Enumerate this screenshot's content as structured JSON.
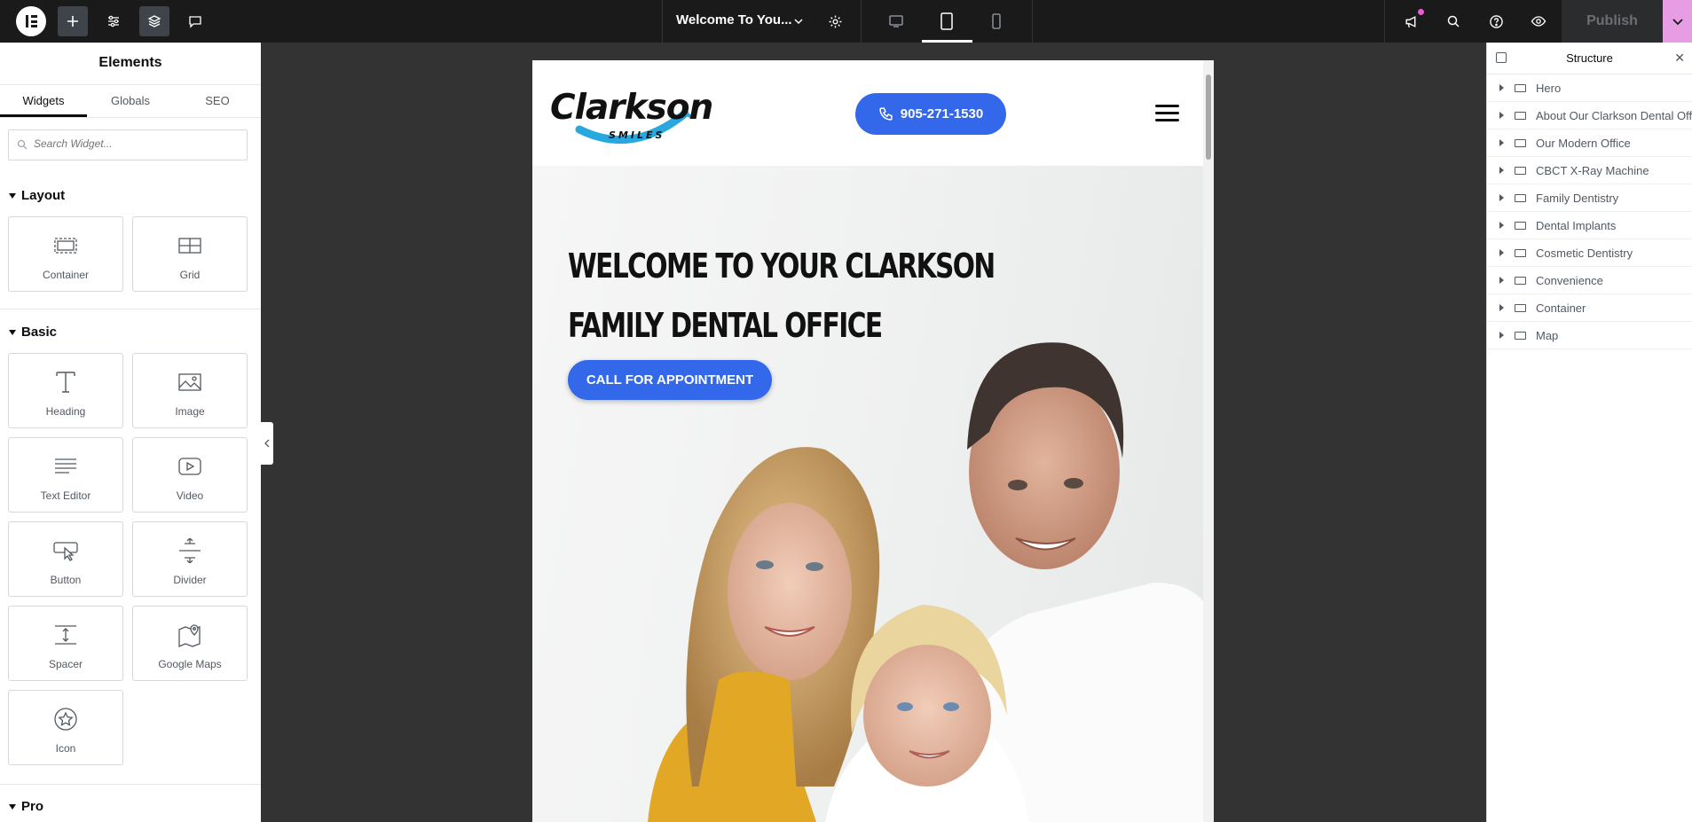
{
  "topbar": {
    "document_title": "Welcome To You...",
    "publish_label": "Publish",
    "icons": [
      "elementor-logo-icon",
      "add-icon",
      "settings-sliders-icon",
      "structure-layers-icon",
      "comments-icon",
      "chevron-down-icon",
      "gear-icon",
      "desktop-icon",
      "tablet-icon",
      "mobile-icon",
      "announcements-icon",
      "search-icon",
      "help-icon",
      "preview-eye-icon",
      "chevron-down-icon"
    ],
    "active_device": "tablet",
    "accent_color": "#e79de4"
  },
  "left_panel": {
    "title": "Elements",
    "tabs": [
      "Widgets",
      "Globals",
      "SEO"
    ],
    "active_tab": "Widgets",
    "search_placeholder": "Search Widget...",
    "categories": {
      "layout": {
        "label": "Layout",
        "widgets": [
          {
            "label": "Container",
            "icon": "container-icon"
          },
          {
            "label": "Grid",
            "icon": "grid-icon"
          }
        ]
      },
      "basic": {
        "label": "Basic",
        "widgets": [
          {
            "label": "Heading",
            "icon": "heading-icon"
          },
          {
            "label": "Image",
            "icon": "image-icon"
          },
          {
            "label": "Text Editor",
            "icon": "text-editor-icon"
          },
          {
            "label": "Video",
            "icon": "video-icon"
          },
          {
            "label": "Button",
            "icon": "button-icon"
          },
          {
            "label": "Divider",
            "icon": "divider-icon"
          },
          {
            "label": "Spacer",
            "icon": "spacer-icon"
          },
          {
            "label": "Google Maps",
            "icon": "google-maps-icon"
          },
          {
            "label": "Icon",
            "icon": "star-icon"
          }
        ]
      },
      "pro": {
        "label": "Pro"
      }
    }
  },
  "preview": {
    "logo_text": "Clarkson",
    "logo_subtext": "SMILES",
    "phone": "905-271-1530",
    "hero_title_line1": "WELCOME TO YOUR CLARKSON",
    "hero_title_line2": "FAMILY DENTAL OFFICE",
    "cta_label": "CALL FOR APPOINTMENT",
    "brand_color": "#3468ea",
    "logo_accent": "#29a8e0"
  },
  "structure_panel": {
    "title": "Structure",
    "items": [
      "Hero",
      "About Our Clarkson Dental Offi...",
      "Our Modern Office",
      "CBCT X-Ray Machine",
      "Family Dentistry",
      "Dental Implants",
      "Cosmetic Dentistry",
      "Convenience",
      "Container",
      "Map"
    ]
  }
}
